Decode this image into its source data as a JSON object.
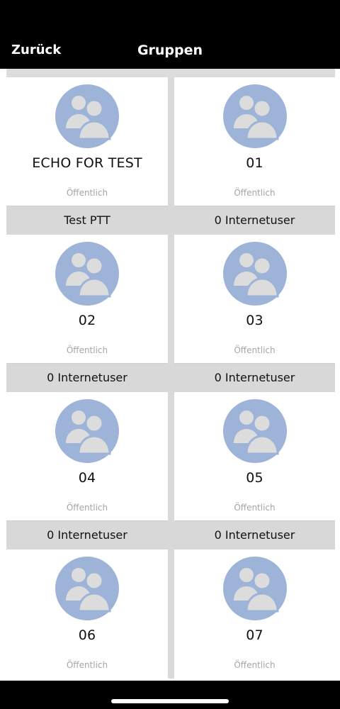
{
  "header": {
    "back_label": "Zurück",
    "title": "Gruppen"
  },
  "colors": {
    "avatar_bg": "#9db3d7",
    "avatar_fg": "#dcdcdc",
    "footer_bg": "#d8d8d8"
  },
  "groups": [
    {
      "name": "ECHO FOR TEST",
      "visibility": "Öffentlich",
      "status": "Test PTT"
    },
    {
      "name": "01",
      "visibility": "Öffentlich",
      "status": "0 Internetuser"
    },
    {
      "name": "02",
      "visibility": "Öffentlich",
      "status": "0 Internetuser"
    },
    {
      "name": "03",
      "visibility": "Öffentlich",
      "status": "0 Internetuser"
    },
    {
      "name": "04",
      "visibility": "Öffentlich",
      "status": "0 Internetuser"
    },
    {
      "name": "05",
      "visibility": "Öffentlich",
      "status": "0 Internetuser"
    },
    {
      "name": "06",
      "visibility": "Öffentlich"
    },
    {
      "name": "07",
      "visibility": "Öffentlich"
    }
  ]
}
